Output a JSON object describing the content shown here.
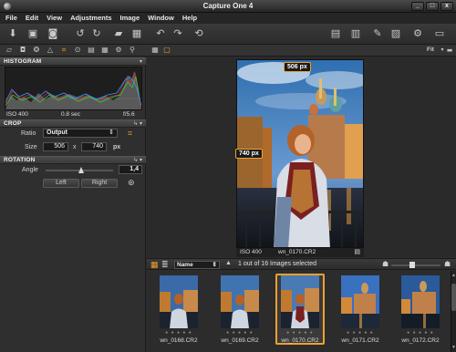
{
  "window": {
    "title": "Capture One 4",
    "minimize": "_",
    "maximize": "□",
    "close": "x"
  },
  "menu": [
    "File",
    "Edit",
    "View",
    "Adjustments",
    "Image",
    "Window",
    "Help"
  ],
  "histogram": {
    "title": "HISTOGRAM",
    "iso": "ISO 400",
    "shutter": "0.8 sec",
    "aperture": "f/5.6"
  },
  "crop": {
    "title": "CROP",
    "ratio_label": "Ratio",
    "ratio_value": "Output",
    "size_label": "Size",
    "width": "506",
    "x": "x",
    "height": "740",
    "unit": "px"
  },
  "rotation": {
    "title": "ROTATION",
    "angle_label": "Angle",
    "angle_value": "1,4",
    "left_button": "Left",
    "right_button": "Right"
  },
  "viewer": {
    "fit_label": "Fit",
    "width_badge": "506 px",
    "height_badge": "740 px",
    "iso": "ISO 400",
    "filename": "wn_0170.CR2"
  },
  "browser": {
    "sort_label": "Name",
    "count_text": "1 out of 16 Images selected"
  },
  "thumbnails": [
    {
      "name": "wn_0168.CR2",
      "selected": false
    },
    {
      "name": "wn_0169.CR2",
      "selected": false
    },
    {
      "name": "wn_0170.CR2",
      "selected": true
    },
    {
      "name": "wn_0171.CR2",
      "selected": false
    },
    {
      "name": "wn_0172.CR2",
      "selected": false
    }
  ],
  "colors": {
    "accent": "#f0a030",
    "background": "#2d2d2d"
  }
}
